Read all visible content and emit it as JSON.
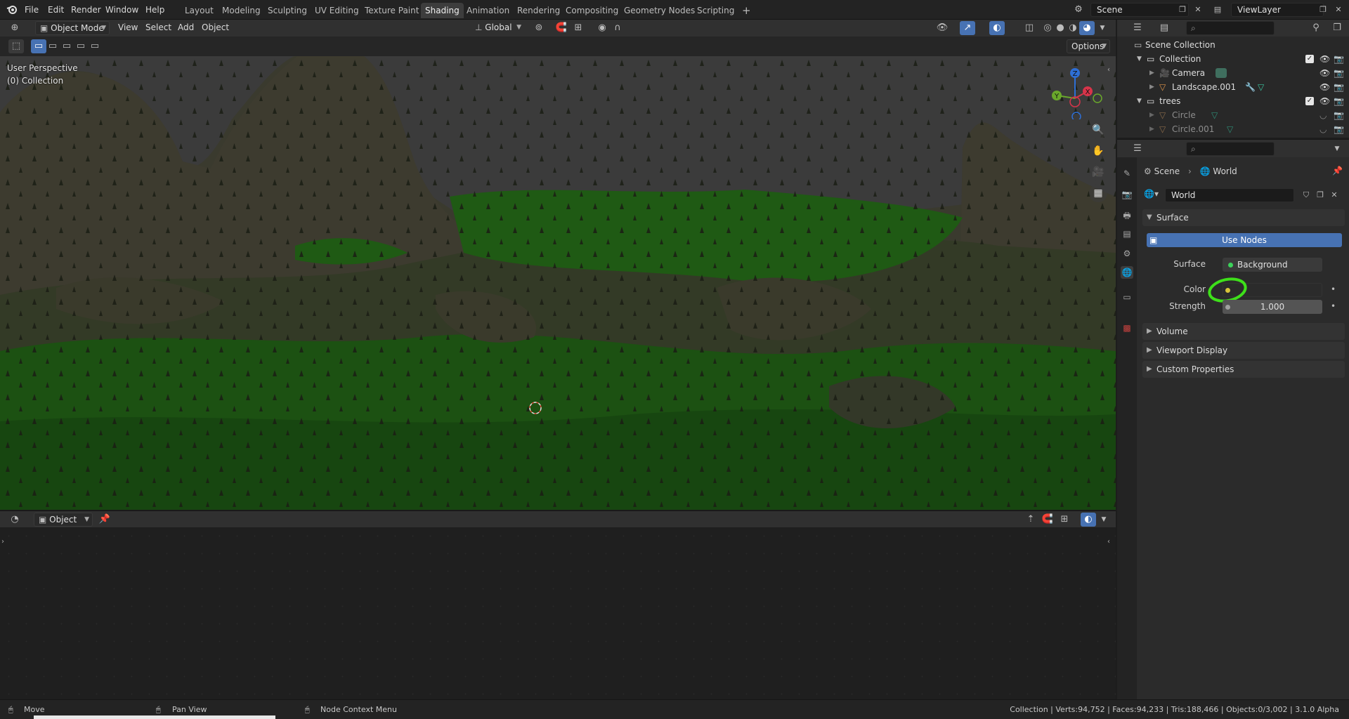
{
  "topbar": {
    "menu": [
      "File",
      "Edit",
      "Render",
      "Window",
      "Help"
    ],
    "workspaces": [
      "Layout",
      "Modeling",
      "Sculpting",
      "UV Editing",
      "Texture Paint",
      "Shading",
      "Animation",
      "Rendering",
      "Compositing",
      "Geometry Nodes",
      "Scripting"
    ],
    "active_workspace": "Shading",
    "add_workspace": "+",
    "scene": "Scene",
    "view_layer": "ViewLayer"
  },
  "viewport_header": {
    "mode": "Object Mode",
    "menus": [
      "View",
      "Select",
      "Add",
      "Object"
    ],
    "transform_orientation": "Global",
    "options_label": "Options"
  },
  "viewport": {
    "perspective_label": "User Perspective",
    "collection_label": "(0) Collection",
    "gizmo": {
      "z": "Z",
      "y": "Y",
      "x": "X"
    }
  },
  "node_editor": {
    "object_dropdown": "Object"
  },
  "outliner": {
    "rows": [
      {
        "label": "Scene Collection",
        "level": 0,
        "icon": "scene-collection-icon"
      },
      {
        "label": "Collection",
        "level": 1,
        "icon": "collection-icon"
      },
      {
        "label": "Camera",
        "level": 2,
        "icon": "camera-icon"
      },
      {
        "label": "Landscape.001",
        "level": 2,
        "icon": "mesh-icon"
      },
      {
        "label": "trees",
        "level": 1,
        "icon": "collection-icon"
      },
      {
        "label": "Circle",
        "level": 2,
        "icon": "mesh-icon",
        "dim": true
      },
      {
        "label": "Circle.001",
        "level": 2,
        "icon": "mesh-icon",
        "dim": true
      }
    ]
  },
  "properties": {
    "breadcrumb_scene": "Scene",
    "breadcrumb_world": "World",
    "world_name": "World",
    "surface_panel": "Surface",
    "use_nodes": "Use Nodes",
    "surface_label": "Surface",
    "surface_value": "Background",
    "color_label": "Color",
    "strength_label": "Strength",
    "strength_value": "1.000",
    "panels": [
      "Volume",
      "Viewport Display",
      "Custom Properties"
    ]
  },
  "statusbar": {
    "move": "Move",
    "pan_view": "Pan View",
    "node_context_menu": "Node Context Menu",
    "stats": "Collection | Verts:94,752 | Faces:94,233 | Tris:188,466 | Objects:0/3,002 | 3.1.0 Alpha"
  },
  "colors": {
    "accent_blue": "#4772b3",
    "grass": "#1f6b12",
    "highlight_circle": "#3ee01a"
  }
}
